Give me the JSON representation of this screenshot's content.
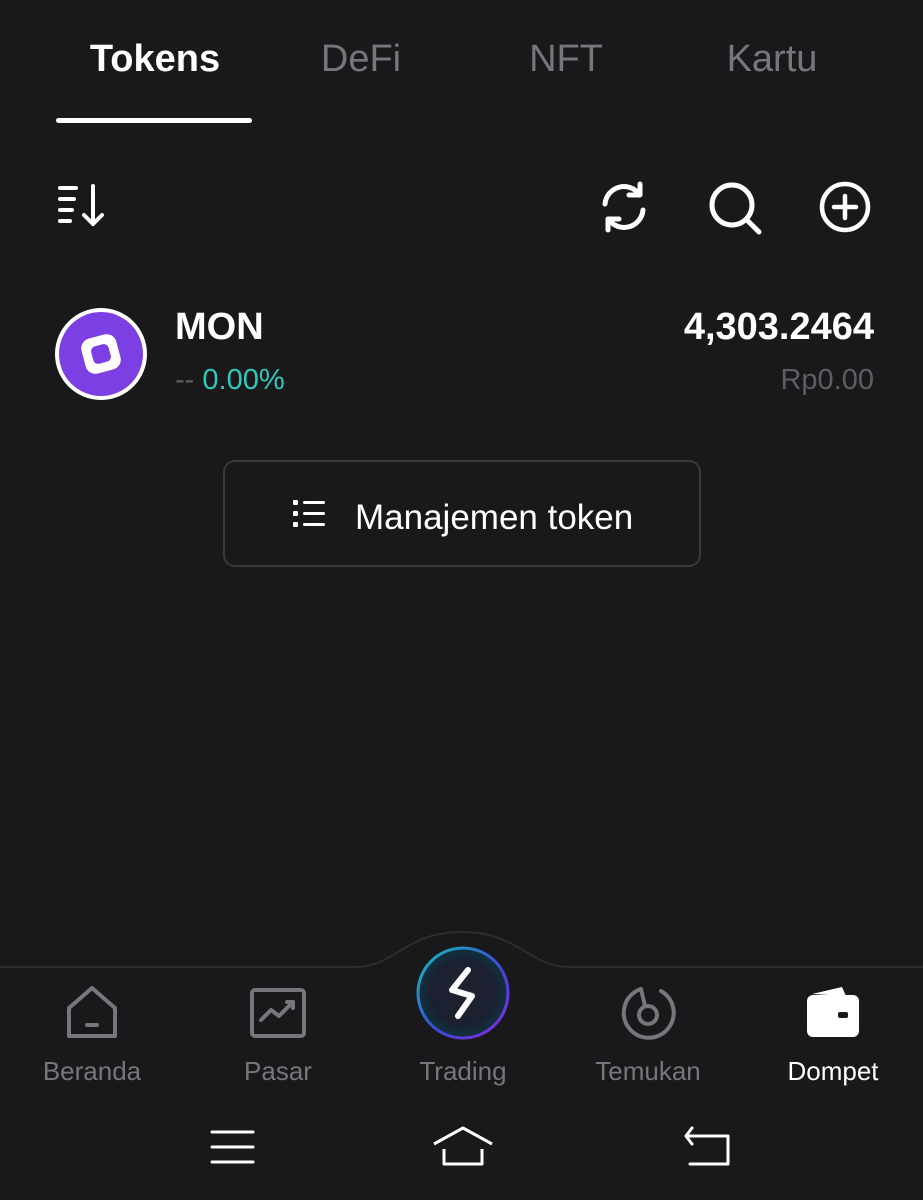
{
  "tabs": [
    {
      "label": "Tokens",
      "active": true
    },
    {
      "label": "DeFi",
      "active": false
    },
    {
      "label": "NFT",
      "active": false
    },
    {
      "label": "Kartu",
      "active": false
    }
  ],
  "toolbar": {
    "sort_icon": "sort-descending-icon",
    "refresh_icon": "refresh-icon",
    "search_icon": "search-icon",
    "add_icon": "add-circle-icon"
  },
  "tokens": [
    {
      "symbol": "MON",
      "logo_icon": "monad-logo-icon",
      "logo_color": "#7b3fe4",
      "price_change_prefix": "--",
      "price_change": "0.00%",
      "change_color": "#2ec9b7",
      "balance": "4,303.2464",
      "fiat_value": "Rp0.00"
    }
  ],
  "manage_button": {
    "label": "Manajemen token",
    "icon": "list-icon"
  },
  "bottom_nav": [
    {
      "label": "Beranda",
      "icon": "home-icon",
      "active": false
    },
    {
      "label": "Pasar",
      "icon": "market-chart-icon",
      "active": false
    },
    {
      "label": "Trading",
      "icon": "trading-swap-icon",
      "active": false
    },
    {
      "label": "Temukan",
      "icon": "discover-icon",
      "active": false
    },
    {
      "label": "Dompet",
      "icon": "wallet-icon",
      "active": true
    }
  ],
  "system_bar": {
    "menu_icon": "menu-icon",
    "home_icon": "home-nav-icon",
    "back_icon": "back-icon"
  },
  "colors": {
    "background": "#19191b",
    "text_primary": "#ffffff",
    "text_muted": "#77777b",
    "accent_teal": "#2ec9b7",
    "border": "#3a3a3d"
  }
}
